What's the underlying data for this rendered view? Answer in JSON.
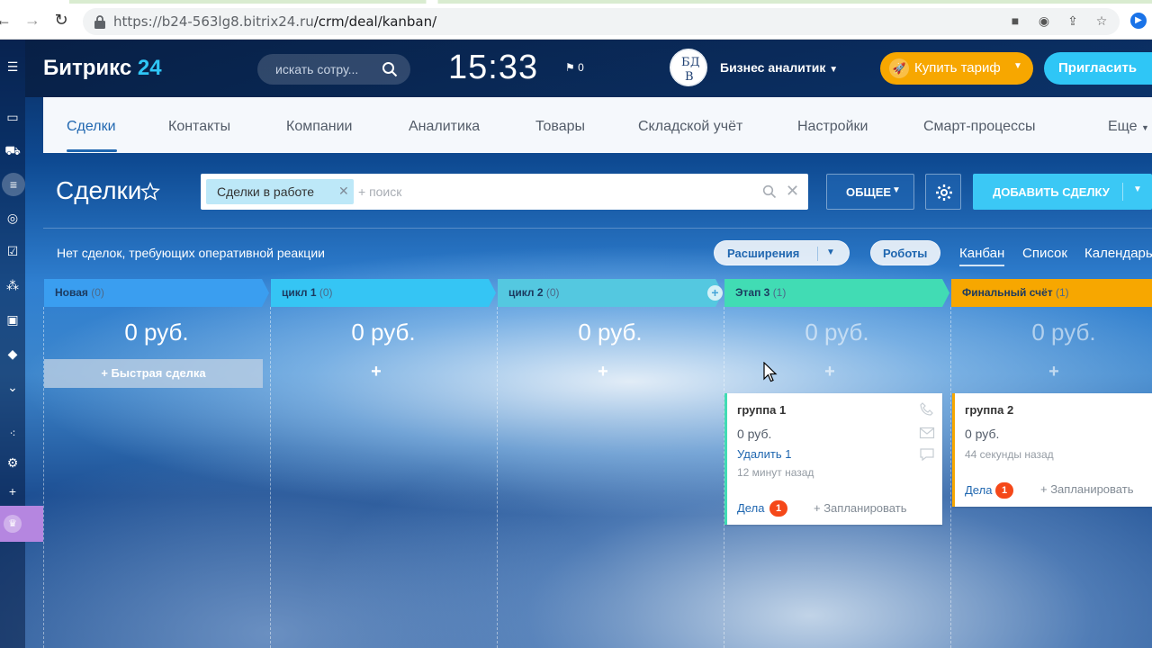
{
  "browser": {
    "url_host": "https://b24-563lg8.bitrix24.ru",
    "url_path": "/crm/deal/kanban/"
  },
  "portal": {
    "logo_text": "Битрикс",
    "logo_num": "24",
    "search_placeholder": "искать сотру...",
    "clock": "15:33",
    "flag_count": "0",
    "avatar_letters": [
      "Б",
      "Д",
      "В"
    ],
    "user_name": "Бизнес аналитик",
    "buy_label": "Купить тариф",
    "invite_label": "Пригласить"
  },
  "tabs": [
    "Сделки",
    "Контакты",
    "Компании",
    "Аналитика",
    "Товары",
    "Складской учёт",
    "Настройки",
    "Смарт-процессы",
    "Еще"
  ],
  "page": {
    "title": "Сделки",
    "filter_tag": "Сделки в работе",
    "filter_placeholder": "+ поиск",
    "general_label": "ОБЩЕЕ",
    "add_deal_label": "ДОБАВИТЬ СДЕЛКУ",
    "notice": "Нет сделок, требующих оперативной реакции",
    "extensions_label": "Расширения",
    "robots_label": "Роботы",
    "views": [
      "Канбан",
      "Список",
      "Календарь"
    ]
  },
  "kanban": {
    "columns": [
      {
        "name": "Новая",
        "count": "(0)",
        "sum": "0 руб.",
        "color": "#3a9ef0"
      },
      {
        "name": "цикл 1",
        "count": "(0)",
        "sum": "0 руб.",
        "color": "#35c5f4"
      },
      {
        "name": "цикл 2",
        "count": "(0)",
        "sum": "0 руб.",
        "color": "#54c8e0"
      },
      {
        "name": "Этап 3",
        "count": "(1)",
        "sum": "0 руб.",
        "color": "#41dcb4"
      },
      {
        "name": "Финальный счёт",
        "count": "(1)",
        "sum": "0 руб.",
        "color": "#f7a700"
      }
    ],
    "quick_deal": "Быстрая сделка",
    "plus": "+",
    "cards": [
      {
        "title": "группа 1",
        "sum": "0 руб.",
        "link": "Удалить 1",
        "time": "12 минут назад",
        "deals": "Дела",
        "badge": "1",
        "plan": "+ Запланировать",
        "bar": "#41dcb4"
      },
      {
        "title": "группа 2",
        "sum": "0 руб.",
        "time": "44 секунды назад",
        "deals": "Дела",
        "badge": "1",
        "plan": "+ Запланировать",
        "bar": "#f7a700"
      }
    ]
  },
  "colors": {
    "accent_blue": "#2067b0",
    "cyan": "#2fc6f6",
    "orange": "#f7a700",
    "badge_red": "#f54819"
  }
}
